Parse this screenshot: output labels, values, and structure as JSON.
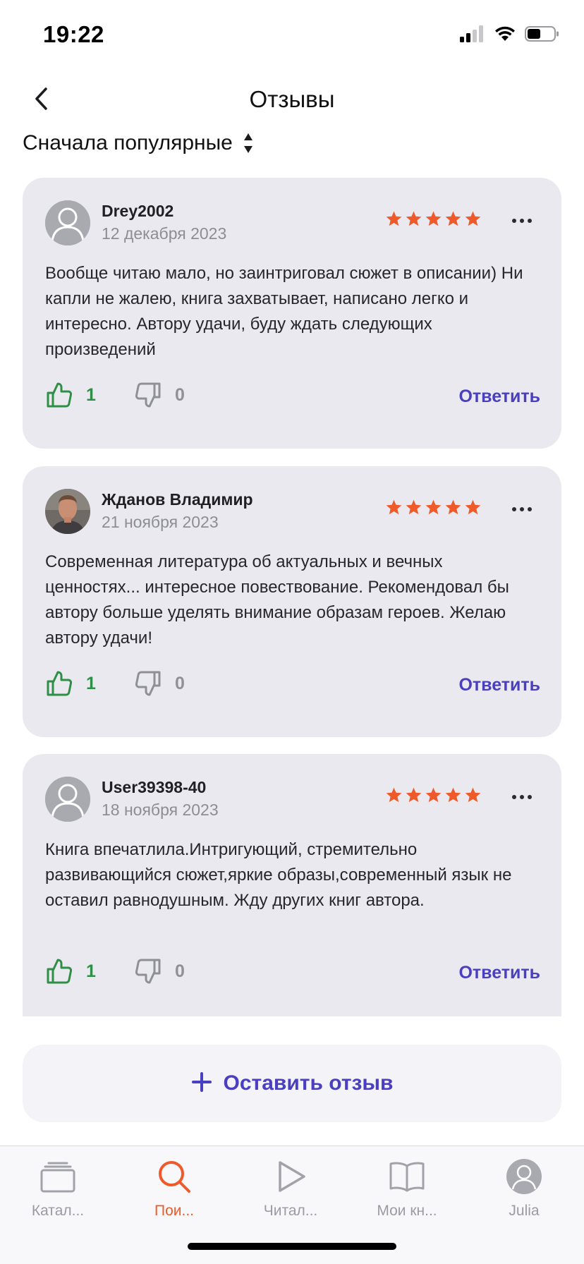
{
  "status_bar": {
    "time": "19:22"
  },
  "header": {
    "title": "Отзывы"
  },
  "sort": {
    "label": "Сначала популярные"
  },
  "colors": {
    "accent": "#4a3fc0",
    "star": "#ee5a2a",
    "like": "#2f8f46",
    "active_tab": "#ee5a2a"
  },
  "reviews": [
    {
      "author": "Drey2002",
      "date": "12 декабря 2023",
      "rating": 5,
      "text": "Вообще читаю мало, но заинтриговал сюжет в описании) Ни капли не жалею, книга захватывает, написано легко и интересно. Автору удачи, буду ждать следующих произведений",
      "likes": "1",
      "dislikes": "0",
      "reply_label": "Ответить"
    },
    {
      "author": "Жданов Владимир",
      "date": "21 ноября 2023",
      "rating": 5,
      "text": "Современная литература об актуальных и вечных ценностях... интересное повествование. Рекомендовал бы автору больше уделять внимание образам героев. Желаю автору удачи!",
      "likes": "1",
      "dislikes": "0",
      "reply_label": "Ответить"
    },
    {
      "author": "User39398-40",
      "date": "18 ноября 2023",
      "rating": 5,
      "text": "Книга впечатлила.Интригующий, стремительно развивающийся сюжет,яркие образы,современный язык не оставил равнодушным. Жду других книг автора.",
      "likes": "1",
      "dislikes": "0",
      "reply_label": "Ответить"
    }
  ],
  "leave_review": {
    "label": "Оставить отзыв"
  },
  "tabs": [
    {
      "label": "Катал...",
      "icon": "catalog-icon"
    },
    {
      "label": "Пои...",
      "icon": "search-icon",
      "active": true
    },
    {
      "label": "Читал...",
      "icon": "play-icon"
    },
    {
      "label": "Мои кн...",
      "icon": "book-icon"
    },
    {
      "label": "Julia",
      "icon": "profile-avatar"
    }
  ]
}
